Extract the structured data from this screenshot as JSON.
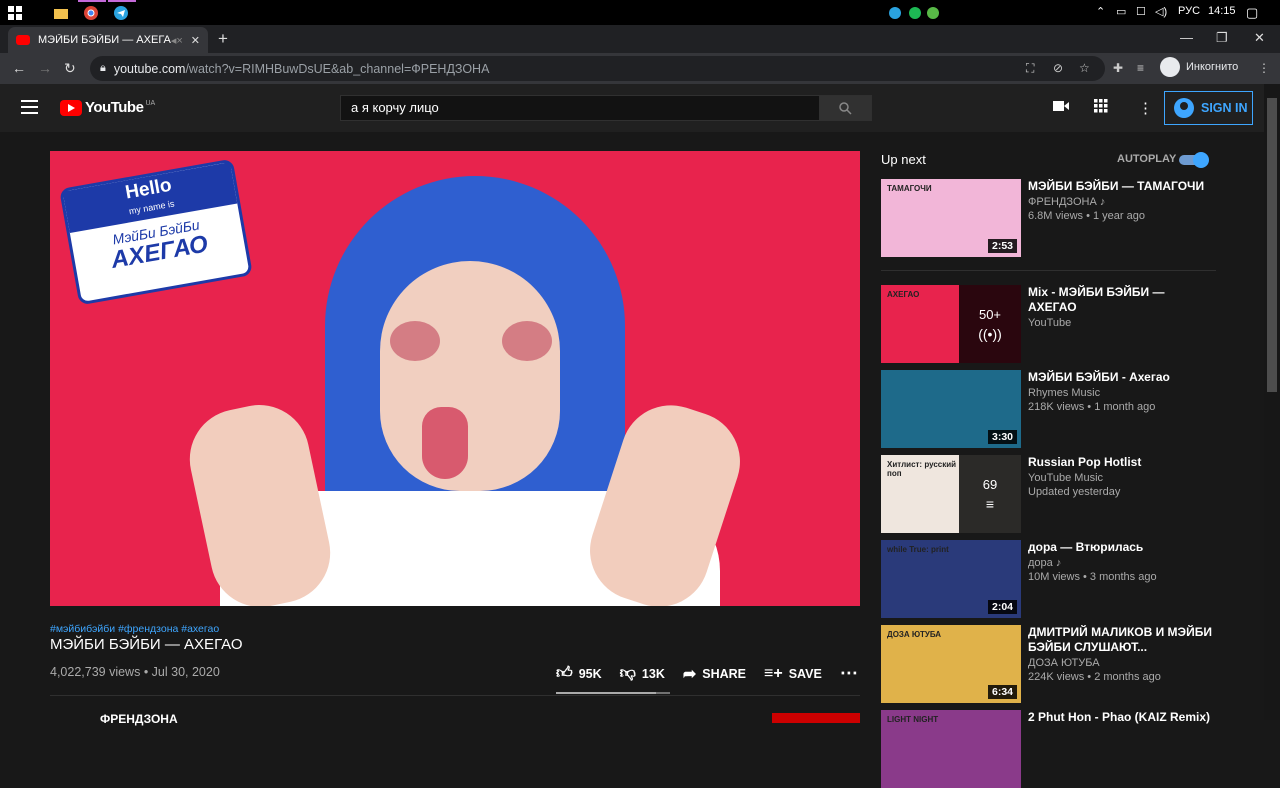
{
  "taskbar": {
    "lang": "РУС",
    "time": "14:15"
  },
  "browser": {
    "tab_title": "МЭЙБИ БЭЙБИ — АХЕГАО",
    "new_tab": "+",
    "url_host": "youtube.com",
    "url_path": "/watch?v=RIMHBuwDsUE&ab_channel=ФРЕНДЗОНА",
    "incognito_label": "Инкогнито"
  },
  "youtube": {
    "logo": "YouTube",
    "country": "UA",
    "search_value": "а я корчу лицо",
    "signin": "SIGN IN"
  },
  "thumbnail_tag": {
    "hello": "Hello",
    "my_name": "my name is",
    "name1": "МэйБи БэйБи",
    "name2": "АХЕГАО"
  },
  "video": {
    "hashtags": "#мэйбибэйби #френдзона #ахегао",
    "title": "МЭЙБИ БЭЙБИ — АХЕГАО",
    "views": "4,022,739 views",
    "date": "Jul 30, 2020",
    "meta_sep": " • ",
    "likes": "95K",
    "dislikes": "13K",
    "share": "SHARE",
    "save": "SAVE",
    "like_ratio": 0.88,
    "channel": "ФРЕНДЗОНА"
  },
  "upnext": {
    "label": "Up next",
    "autoplay": "AUTOPLAY",
    "autoplay_on": true,
    "items": [
      {
        "title": "МЭЙБИ БЭЙБИ — ТАМАГОЧИ",
        "channel": "ФРЕНДЗОНА ♪",
        "meta": "6.8M views • 1 year ago",
        "duration": "2:53",
        "color": "#f2b6d8",
        "thumb_text": "ТАМАГОЧИ"
      },
      {
        "title": "Mix - МЭЙБИ БЭЙБИ — АХЕГАО",
        "channel": "YouTube",
        "meta": "",
        "duration": "",
        "color": "#e8234d",
        "panel_top": "50+",
        "panel_sym": "((•))",
        "thumb_text": "АХЕГАО"
      },
      {
        "title": "МЭЙБИ БЭЙБИ - Ахегао",
        "channel": "Rhymes Music",
        "meta": "218K views • 1 month ago",
        "duration": "3:30",
        "color": "#1e6a8a",
        "thumb_text": ""
      },
      {
        "title": "Russian Pop Hotlist",
        "channel": "YouTube Music",
        "meta": "Updated yesterday",
        "duration": "",
        "color": "#efe6de",
        "panel_top": "69",
        "panel_sym": "≡",
        "thumb_text": "Хитлист: русский поп"
      },
      {
        "title": "дора — Втюрилась",
        "channel": "дора ♪",
        "meta": "10M views • 3 months ago",
        "duration": "2:04",
        "color": "#2a3a7a",
        "thumb_text": "while True: print"
      },
      {
        "title": "ДМИТРИЙ МАЛИКОВ И МЭЙБИ БЭЙБИ СЛУШАЮТ...",
        "channel": "ДОЗА ЮТУБА",
        "meta": "224K views • 2 months ago",
        "duration": "6:34",
        "color": "#e0b24a",
        "thumb_text": "ДОЗА ЮТУБА"
      },
      {
        "title": "2 Phut Hon - Phao (KAIZ Remix)",
        "channel": "",
        "meta": "",
        "duration": "",
        "color": "#8a3a8a",
        "thumb_text": "LIGHT NIGHT"
      }
    ]
  }
}
